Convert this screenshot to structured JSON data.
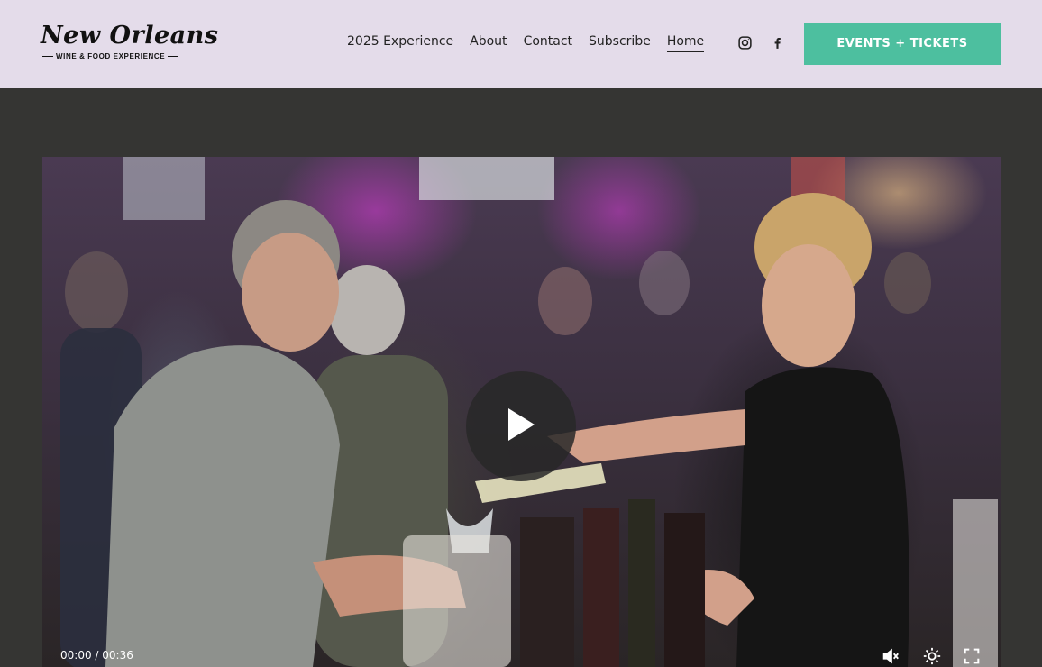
{
  "header": {
    "logo": {
      "script": "New Orleans",
      "subtitle": "WINE & FOOD EXPERIENCE"
    },
    "nav": [
      {
        "label": "2025 Experience"
      },
      {
        "label": "About"
      },
      {
        "label": "Contact"
      },
      {
        "label": "Subscribe"
      },
      {
        "label": "Home",
        "active": true
      }
    ],
    "social": [
      "instagram-icon",
      "facebook-icon"
    ],
    "cta_label": "EVENTS + TICKETS"
  },
  "video": {
    "current_time": "00:00",
    "duration": "00:36",
    "controls": [
      "play-icon",
      "mute-icon",
      "settings-icon",
      "fullscreen-icon"
    ]
  },
  "colors": {
    "header_bg": "#e4dcea",
    "page_bg": "#353533",
    "cta_bg": "#4dbf9f"
  }
}
